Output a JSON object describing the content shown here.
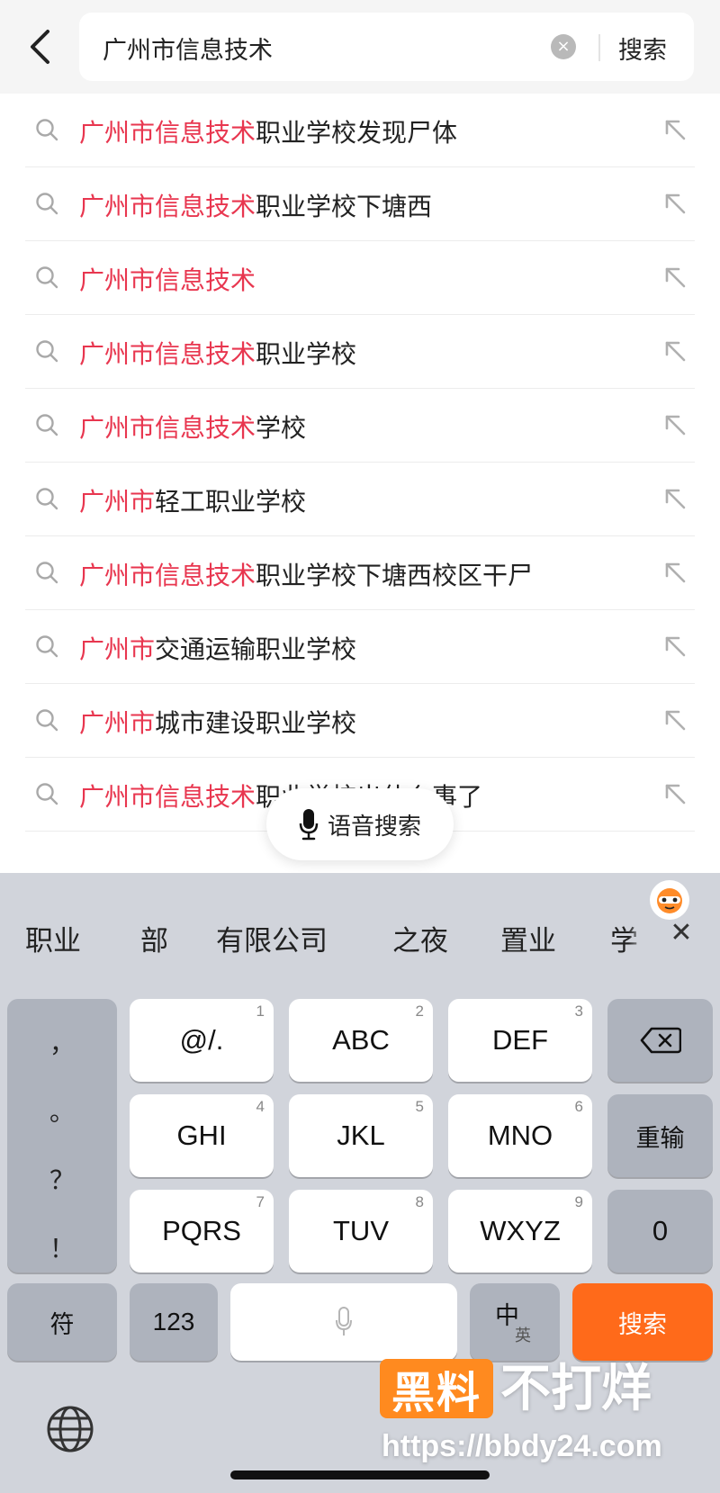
{
  "header": {
    "query": "广州市信息技术",
    "search_label": "搜索"
  },
  "suggestions": [
    {
      "highlight": "广州市信息技术",
      "rest": "职业学校发现尸体"
    },
    {
      "highlight": "广州市信息技术",
      "rest": "职业学校下塘西"
    },
    {
      "highlight": "广州市信息技术",
      "rest": ""
    },
    {
      "highlight": "广州市信息技术",
      "rest": "职业学校"
    },
    {
      "highlight": "广州市信息技术",
      "rest": "学校"
    },
    {
      "highlight": "广州市",
      "rest": "轻工职业学校"
    },
    {
      "highlight": "广州市信息技术",
      "rest": "职业学校下塘西校区干尸"
    },
    {
      "highlight": "广州市",
      "rest": "交通运输职业学校"
    },
    {
      "highlight": "广州市",
      "rest": "城市建设职业学校"
    },
    {
      "highlight": "广州市信息技术",
      "rest": "职业学校出什么事了"
    }
  ],
  "voice_search": {
    "label": "语音搜索"
  },
  "keyboard": {
    "candidates": [
      "职业",
      "部",
      "有限公司",
      "之夜",
      "置业",
      "学"
    ],
    "punctuation": [
      "，",
      "。",
      "？",
      "！"
    ],
    "keys": {
      "k1": {
        "label": "@/.",
        "num": "1"
      },
      "k2": {
        "label": "ABC",
        "num": "2"
      },
      "k3": {
        "label": "DEF",
        "num": "3"
      },
      "k4": {
        "label": "GHI",
        "num": "4"
      },
      "k5": {
        "label": "JKL",
        "num": "5"
      },
      "k6": {
        "label": "MNO",
        "num": "6"
      },
      "k7": {
        "label": "PQRS",
        "num": "7"
      },
      "k8": {
        "label": "TUV",
        "num": "8"
      },
      "k9": {
        "label": "WXYZ",
        "num": "9"
      }
    },
    "retype": "重输",
    "zero": "0",
    "symbols": "符",
    "numbers": "123",
    "lang_main": "中",
    "lang_alt": "英",
    "search": "搜索"
  },
  "watermark": {
    "badge": "黑料",
    "text": "不打烊",
    "url": "https://bbdy24.com"
  },
  "colors": {
    "highlight": "#e8364f",
    "accent_orange": "#ff6a1a",
    "keyboard_bg": "#d1d4db"
  }
}
